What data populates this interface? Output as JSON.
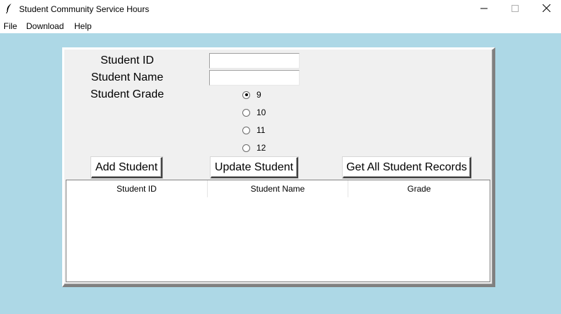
{
  "window": {
    "title": "Student Community Service Hours",
    "controls": {
      "minimize": "minimize-icon",
      "maximize": "maximize-icon",
      "close": "close-icon"
    }
  },
  "menu": {
    "file": "File",
    "download": "Download",
    "help": "Help"
  },
  "form": {
    "student_id_label": "Student ID",
    "student_name_label": "Student Name",
    "student_grade_label": "Student Grade",
    "student_id_value": "",
    "student_name_value": "",
    "grades": [
      "9",
      "10",
      "11",
      "12"
    ],
    "selected_grade": "9"
  },
  "buttons": {
    "add": "Add Student",
    "update": "Update Student",
    "get_all": "Get All Student Records"
  },
  "table": {
    "columns": [
      "Student ID",
      "Student Name",
      "Grade"
    ],
    "rows": []
  },
  "colors": {
    "background": "#add8e6",
    "frame": "#f0f0f0"
  }
}
